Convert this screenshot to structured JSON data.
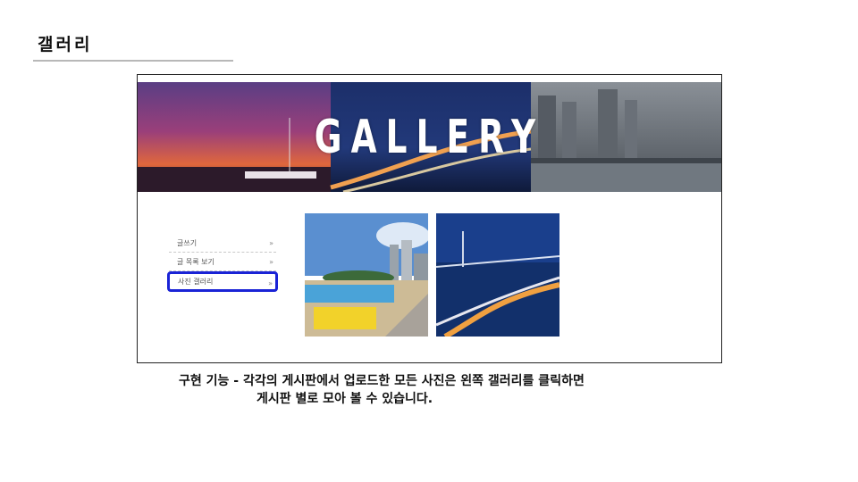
{
  "slide": {
    "title": "갤러리",
    "caption_line1": "구현 기능 - 각각의 게시판에서 업로드한 모든 사진은 왼쪽 갤러리를 클릭하면",
    "caption_line2": "게시판 별로 모아 볼 수 있습니다."
  },
  "banner": {
    "text": "GALLERY"
  },
  "menu": {
    "items": [
      {
        "label": "글쓰기",
        "arrow": "»"
      },
      {
        "label": "글 목록 보기",
        "arrow": "»"
      },
      {
        "label": "사진 갤러리",
        "arrow": "»"
      }
    ],
    "active_index": 2
  },
  "colors": {
    "highlight": "#1a23d6"
  }
}
